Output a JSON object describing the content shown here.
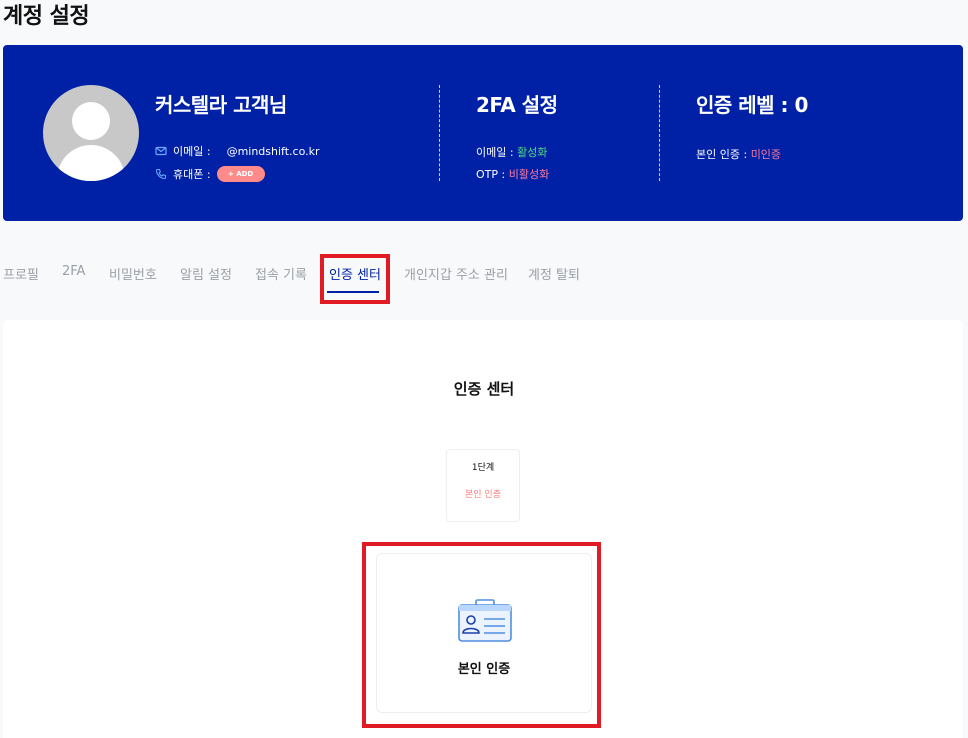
{
  "page": {
    "title": "계정 설정"
  },
  "profile": {
    "name": "커스텔라 고객님",
    "email_label": "이메일 :",
    "email_value": "@mindshift.co.kr",
    "phone_label": "휴대폰 :",
    "add_button": "+ ADD"
  },
  "twofa": {
    "title": "2FA 설정",
    "email_label": "이메일 : ",
    "email_status": "활성화",
    "otp_label": "OTP : ",
    "otp_status": "비활성화"
  },
  "level": {
    "title": "인증 레벨 : 0",
    "identity_label": "본인 인증 : ",
    "identity_status": "미인증"
  },
  "tabs": [
    {
      "label": "프로필"
    },
    {
      "label": "2FA"
    },
    {
      "label": "비밀번호"
    },
    {
      "label": "알림 설정"
    },
    {
      "label": "접속 기록"
    },
    {
      "label": "인증 센터",
      "active": true
    },
    {
      "label": "개인지갑 주소 관리"
    },
    {
      "label": "계정 탈퇴"
    }
  ],
  "center": {
    "title": "인증 센터",
    "step_label": "1단계",
    "step_status": "본인 인증",
    "card_label": "본인 인증"
  },
  "colors": {
    "banner": "#0021a5",
    "active_status": "#4ade80",
    "inactive_status": "#ff7a9c",
    "highlight": "#e01b24"
  },
  "icons": [
    "mail-icon",
    "phone-icon",
    "id-card-icon",
    "avatar-placeholder"
  ]
}
